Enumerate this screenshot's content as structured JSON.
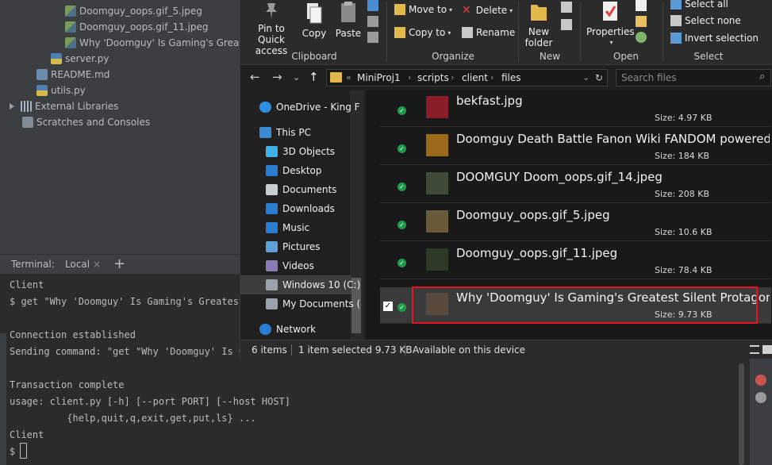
{
  "ide": {
    "project_tree": [
      {
        "label": "Doomguy_oops.gif_5.jpeg",
        "icon": "image-file-icon"
      },
      {
        "label": "Doomguy_oops.gif_11.jpeg",
        "icon": "image-file-icon"
      },
      {
        "label": "Why 'Doomguy' Is Gaming's Greatest S",
        "icon": "image-file-icon"
      },
      {
        "label": "server.py",
        "icon": "python-file-icon"
      },
      {
        "label": "README.md",
        "icon": "markdown-file-icon"
      },
      {
        "label": "utils.py",
        "icon": "python-file-icon"
      },
      {
        "label": "External Libraries",
        "icon": "library-icon"
      },
      {
        "label": "Scratches and Consoles",
        "icon": "scratch-icon"
      }
    ],
    "terminal": {
      "title": "Terminal:",
      "tab_label": "Local",
      "close_glyph": "×",
      "add_glyph": "+",
      "lines": [
        "Client",
        "$ get \"Why 'Doomguy' Is Gaming's Greatest",
        "",
        "Connection established",
        "Sending command: \"get \"Why 'Doomguy' Is Ga",
        "",
        "Transaction complete",
        "usage: client.py [-h] [--port PORT] [--host HOST]",
        "          {help,quit,q,exit,get,put,ls} ...",
        "Client",
        "$"
      ]
    }
  },
  "explorer": {
    "ribbon": {
      "pin_label": "Pin to Quick access",
      "copy_label": "Copy",
      "paste_label": "Paste",
      "clipboard_group": "Clipboard",
      "move_to_label": "Move to",
      "copy_to_label": "Copy to",
      "delete_label": "Delete",
      "rename_label": "Rename",
      "organize_group": "Organize",
      "new_folder_label": "New folder",
      "new_group": "New",
      "properties_label": "Properties",
      "open_group": "Open",
      "select_all_label": "Select all",
      "select_none_label": "Select none",
      "invert_selection_label": "Invert selection",
      "select_group": "Select",
      "dropdown_glyph": "▾"
    },
    "address": {
      "prefix": "«",
      "crumbs": [
        "MiniProj1",
        "scripts",
        "client",
        "files"
      ],
      "crumb_sep": "›",
      "search_placeholder": "Search files",
      "back_glyph": "←",
      "forward_glyph": "→",
      "history_glyph": "⌄",
      "up_glyph": "↑",
      "dropdown_glyph": "⌄",
      "refresh_glyph": "↻",
      "search_glyph": "⌕"
    },
    "nav_pane": [
      {
        "label": "OneDrive - King F",
        "icon": "onedrive-icon",
        "color": "#2f8fe0"
      },
      {
        "label": "This PC",
        "icon": "pc-icon",
        "color": "#3a8ad4"
      },
      {
        "label": "3D Objects",
        "icon": "3d-objects-icon",
        "color": "#3fb1e8"
      },
      {
        "label": "Desktop",
        "icon": "desktop-icon",
        "color": "#2b7cd3"
      },
      {
        "label": "Documents",
        "icon": "documents-icon",
        "color": "#c8cdd3"
      },
      {
        "label": "Downloads",
        "icon": "downloads-icon",
        "color": "#2b7cd3"
      },
      {
        "label": "Music",
        "icon": "music-icon",
        "color": "#2b7cd3"
      },
      {
        "label": "Pictures",
        "icon": "pictures-icon",
        "color": "#5fa0d8"
      },
      {
        "label": "Videos",
        "icon": "videos-icon",
        "color": "#8a7ab8"
      },
      {
        "label": "Windows 10 (C:)",
        "icon": "drive-icon",
        "color": "#9aa3ad"
      },
      {
        "label": "My Documents (",
        "icon": "network-drive-icon",
        "color": "#9aa3ad"
      },
      {
        "label": "Network",
        "icon": "network-icon",
        "color": "#2b7cd3"
      }
    ],
    "files": [
      {
        "name": "bekfast.jpg",
        "size": "Size: 4.97 KB",
        "thumb": "#8a1f2a",
        "selected": false
      },
      {
        "name": "Doomguy Death Battle Fanon Wiki FANDOM powered by ...",
        "size": "Size: 184 KB",
        "thumb": "#9a6a1a",
        "selected": false
      },
      {
        "name": "DOOMGUY Doom_oops.gif_14.jpeg",
        "size": "Size: 208 KB",
        "thumb": "#3f4a3a",
        "selected": false
      },
      {
        "name": "Doomguy_oops.gif_5.jpeg",
        "size": "Size: 10.6 KB",
        "thumb": "#6b5a3a",
        "selected": false
      },
      {
        "name": "Doomguy_oops.gif_11.jpeg",
        "size": "Size: 78.4 KB",
        "thumb": "#2e3a28",
        "selected": false
      },
      {
        "name": "Why 'Doomguy' Is Gaming's Greatest Silent Protagonist - VI...",
        "size": "Size: 9.73 KB",
        "thumb": "#5a4a3e",
        "selected": true
      }
    ],
    "sync_glyph": "✓",
    "checkbox_glyph": "✓",
    "status": {
      "items_count": "6 items",
      "selection": "1 item selected  9.73 KB",
      "availability": "Available on this device"
    }
  },
  "colors": {
    "highlight_border": "#e81123",
    "sync_ok": "#1e9d47",
    "folder": "#e3b84a"
  }
}
